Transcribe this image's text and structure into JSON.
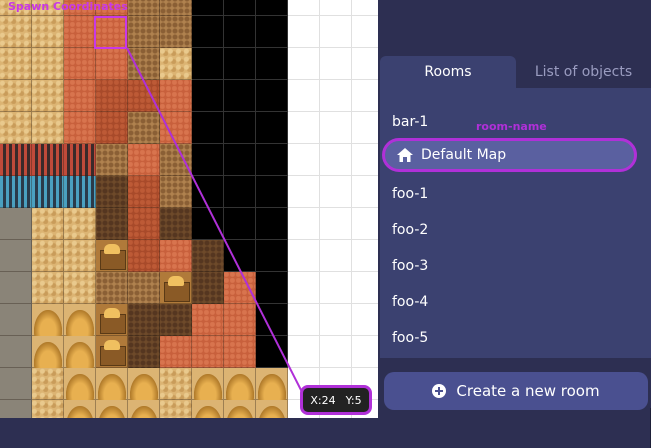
{
  "map": {
    "spawn_label": "Spawn Coordinates",
    "coords": {
      "x": "X:24",
      "y": "Y:5"
    }
  },
  "panel": {
    "tabs": [
      "Rooms",
      "List of objects"
    ],
    "room_name_label": "room-name",
    "rooms": [
      "bar-1",
      "Default Map",
      "foo-1",
      "foo-2",
      "foo-3",
      "foo-4",
      "foo-5"
    ],
    "selected_room": "Default Map",
    "create_button": "Create a new room"
  },
  "colors": {
    "annotation": "#b030d8",
    "panel_bg": "#2d2f52",
    "list_bg": "#3b4170",
    "selected_bg": "#5a60a0"
  }
}
